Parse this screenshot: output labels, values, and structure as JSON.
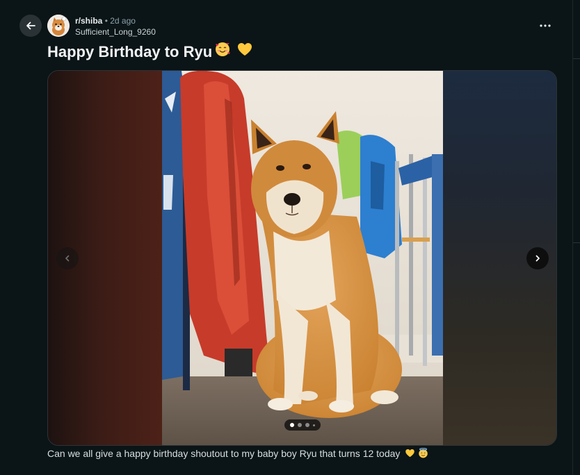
{
  "post": {
    "subreddit": "r/shiba",
    "separator": "•",
    "time": "2d ago",
    "author": "Sufficient_Long_9260",
    "title": "Happy Birthday to Ryu",
    "title_emojis": [
      "smiling-face-with-hearts-emoji",
      "yellow-heart-emoji"
    ],
    "body": "Can we all give a happy birthday shoutout to my baby boy Ryu that turns 12 today",
    "body_emojis": [
      "yellow-heart-emoji",
      "smiling-face-with-halo-emoji"
    ]
  },
  "gallery": {
    "image_alt": "Shiba Inu dog sitting on carpet in front of folded camping chairs",
    "slide_count": 4,
    "current_slide": 1
  },
  "icons": {
    "back": "back-arrow-icon",
    "more": "more-options-icon",
    "prev": "chevron-left-icon",
    "next": "chevron-right-icon"
  },
  "colors": {
    "background": "#0b1416",
    "accent_yellow": "#ffcc4d",
    "meta_gray": "#8ba2ad"
  }
}
